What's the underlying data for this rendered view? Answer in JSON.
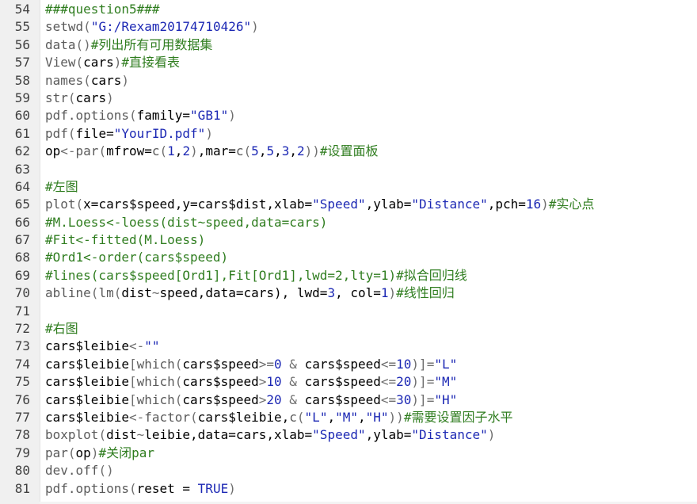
{
  "editor": {
    "lines": [
      {
        "n": "54",
        "segs": [
          {
            "t": "###question5###",
            "c": "cm"
          }
        ]
      },
      {
        "n": "55",
        "segs": [
          {
            "t": "setwd",
            "c": "fn"
          },
          {
            "t": "(",
            "c": "op"
          },
          {
            "t": "\"G:/Rexam20174710426\"",
            "c": "str"
          },
          {
            "t": ")",
            "c": "op"
          }
        ]
      },
      {
        "n": "56",
        "segs": [
          {
            "t": "data",
            "c": "fn"
          },
          {
            "t": "()",
            "c": "op"
          },
          {
            "t": "#列出所有可用数据集",
            "c": "cm"
          }
        ]
      },
      {
        "n": "57",
        "segs": [
          {
            "t": "View",
            "c": "fn"
          },
          {
            "t": "(",
            "c": "op"
          },
          {
            "t": "cars",
            "c": ""
          },
          {
            "t": ")",
            "c": "op"
          },
          {
            "t": "#直接看表",
            "c": "cm"
          }
        ]
      },
      {
        "n": "58",
        "segs": [
          {
            "t": "names",
            "c": "fn"
          },
          {
            "t": "(",
            "c": "op"
          },
          {
            "t": "cars",
            "c": ""
          },
          {
            "t": ")",
            "c": "op"
          }
        ]
      },
      {
        "n": "59",
        "segs": [
          {
            "t": "str",
            "c": "fn"
          },
          {
            "t": "(",
            "c": "op"
          },
          {
            "t": "cars",
            "c": ""
          },
          {
            "t": ")",
            "c": "op"
          }
        ]
      },
      {
        "n": "60",
        "segs": [
          {
            "t": "pdf.options",
            "c": "fn"
          },
          {
            "t": "(",
            "c": "op"
          },
          {
            "t": "family=",
            "c": ""
          },
          {
            "t": "\"GB1\"",
            "c": "str"
          },
          {
            "t": ")",
            "c": "op"
          }
        ]
      },
      {
        "n": "61",
        "segs": [
          {
            "t": "pdf",
            "c": "fn"
          },
          {
            "t": "(",
            "c": "op"
          },
          {
            "t": "file=",
            "c": ""
          },
          {
            "t": "\"YourID.pdf\"",
            "c": "str"
          },
          {
            "t": ")",
            "c": "op"
          }
        ]
      },
      {
        "n": "62",
        "segs": [
          {
            "t": "op",
            "c": ""
          },
          {
            "t": "<-",
            "c": "op"
          },
          {
            "t": "par",
            "c": "fn"
          },
          {
            "t": "(",
            "c": "op"
          },
          {
            "t": "mfrow=",
            "c": ""
          },
          {
            "t": "c",
            "c": "fn"
          },
          {
            "t": "(",
            "c": "op"
          },
          {
            "t": "1",
            "c": "num"
          },
          {
            "t": ",",
            "c": ""
          },
          {
            "t": "2",
            "c": "num"
          },
          {
            "t": ")",
            "c": "op"
          },
          {
            "t": ",mar=",
            "c": ""
          },
          {
            "t": "c",
            "c": "fn"
          },
          {
            "t": "(",
            "c": "op"
          },
          {
            "t": "5",
            "c": "num"
          },
          {
            "t": ",",
            "c": ""
          },
          {
            "t": "5",
            "c": "num"
          },
          {
            "t": ",",
            "c": ""
          },
          {
            "t": "3",
            "c": "num"
          },
          {
            "t": ",",
            "c": ""
          },
          {
            "t": "2",
            "c": "num"
          },
          {
            "t": "))",
            "c": "op"
          },
          {
            "t": "#设置面板",
            "c": "cm"
          }
        ]
      },
      {
        "n": "63",
        "segs": []
      },
      {
        "n": "64",
        "segs": [
          {
            "t": "#左图",
            "c": "cm"
          }
        ]
      },
      {
        "n": "65",
        "segs": [
          {
            "t": "plot",
            "c": "fn"
          },
          {
            "t": "(",
            "c": "op"
          },
          {
            "t": "x=cars$speed,y=cars$dist,xlab=",
            "c": ""
          },
          {
            "t": "\"Speed\"",
            "c": "str"
          },
          {
            "t": ",ylab=",
            "c": ""
          },
          {
            "t": "\"Distance\"",
            "c": "str"
          },
          {
            "t": ",pch=",
            "c": ""
          },
          {
            "t": "16",
            "c": "num"
          },
          {
            "t": ")",
            "c": "op"
          },
          {
            "t": "#实心点",
            "c": "cm"
          }
        ]
      },
      {
        "n": "66",
        "segs": [
          {
            "t": "#M.Loess<-loess(dist~speed,data=cars)",
            "c": "cm"
          }
        ]
      },
      {
        "n": "67",
        "segs": [
          {
            "t": "#Fit<-fitted(M.Loess)",
            "c": "cm"
          }
        ]
      },
      {
        "n": "68",
        "segs": [
          {
            "t": "#Ord1<-order(cars$speed)",
            "c": "cm"
          }
        ]
      },
      {
        "n": "69",
        "segs": [
          {
            "t": "#lines(cars$speed[Ord1],Fit[Ord1],lwd=2,lty=1)#拟合回归线",
            "c": "cm"
          }
        ]
      },
      {
        "n": "70",
        "segs": [
          {
            "t": "abline",
            "c": "fn"
          },
          {
            "t": "(",
            "c": "op"
          },
          {
            "t": "lm",
            "c": "fn"
          },
          {
            "t": "(",
            "c": "op"
          },
          {
            "t": "dist",
            "c": ""
          },
          {
            "t": "~",
            "c": "op"
          },
          {
            "t": "speed,data=cars), lwd=",
            "c": ""
          },
          {
            "t": "3",
            "c": "num"
          },
          {
            "t": ", col=",
            "c": ""
          },
          {
            "t": "1",
            "c": "num"
          },
          {
            "t": ")",
            "c": "op"
          },
          {
            "t": "#线性回归",
            "c": "cm"
          }
        ]
      },
      {
        "n": "71",
        "segs": []
      },
      {
        "n": "72",
        "segs": [
          {
            "t": "#右图",
            "c": "cm"
          }
        ]
      },
      {
        "n": "73",
        "segs": [
          {
            "t": "cars$leibie",
            "c": ""
          },
          {
            "t": "<-",
            "c": "op"
          },
          {
            "t": "\"\"",
            "c": "str"
          }
        ]
      },
      {
        "n": "74",
        "segs": [
          {
            "t": "cars$leibie",
            "c": ""
          },
          {
            "t": "[",
            "c": "op"
          },
          {
            "t": "which",
            "c": "fn"
          },
          {
            "t": "(",
            "c": "op"
          },
          {
            "t": "cars$speed",
            "c": ""
          },
          {
            "t": ">=",
            "c": "op"
          },
          {
            "t": "0",
            "c": "num"
          },
          {
            "t": " & ",
            "c": "op"
          },
          {
            "t": "cars$speed",
            "c": ""
          },
          {
            "t": "<=",
            "c": "op"
          },
          {
            "t": "10",
            "c": "num"
          },
          {
            "t": ")]=",
            "c": "op"
          },
          {
            "t": "\"L\"",
            "c": "str"
          }
        ]
      },
      {
        "n": "75",
        "segs": [
          {
            "t": "cars$leibie",
            "c": ""
          },
          {
            "t": "[",
            "c": "op"
          },
          {
            "t": "which",
            "c": "fn"
          },
          {
            "t": "(",
            "c": "op"
          },
          {
            "t": "cars$speed",
            "c": ""
          },
          {
            "t": ">",
            "c": "op"
          },
          {
            "t": "10",
            "c": "num"
          },
          {
            "t": " & ",
            "c": "op"
          },
          {
            "t": "cars$speed",
            "c": ""
          },
          {
            "t": "<=",
            "c": "op"
          },
          {
            "t": "20",
            "c": "num"
          },
          {
            "t": ")]=",
            "c": "op"
          },
          {
            "t": "\"M\"",
            "c": "str"
          }
        ]
      },
      {
        "n": "76",
        "segs": [
          {
            "t": "cars$leibie",
            "c": ""
          },
          {
            "t": "[",
            "c": "op"
          },
          {
            "t": "which",
            "c": "fn"
          },
          {
            "t": "(",
            "c": "op"
          },
          {
            "t": "cars$speed",
            "c": ""
          },
          {
            "t": ">",
            "c": "op"
          },
          {
            "t": "20",
            "c": "num"
          },
          {
            "t": " & ",
            "c": "op"
          },
          {
            "t": "cars$speed",
            "c": ""
          },
          {
            "t": "<=",
            "c": "op"
          },
          {
            "t": "30",
            "c": "num"
          },
          {
            "t": ")]=",
            "c": "op"
          },
          {
            "t": "\"H\"",
            "c": "str"
          }
        ]
      },
      {
        "n": "77",
        "segs": [
          {
            "t": "cars$leibie",
            "c": ""
          },
          {
            "t": "<-",
            "c": "op"
          },
          {
            "t": "factor",
            "c": "fn"
          },
          {
            "t": "(",
            "c": "op"
          },
          {
            "t": "cars$leibie,",
            "c": ""
          },
          {
            "t": "c",
            "c": "fn"
          },
          {
            "t": "(",
            "c": "op"
          },
          {
            "t": "\"L\"",
            "c": "str"
          },
          {
            "t": ",",
            "c": ""
          },
          {
            "t": "\"M\"",
            "c": "str"
          },
          {
            "t": ",",
            "c": ""
          },
          {
            "t": "\"H\"",
            "c": "str"
          },
          {
            "t": "))",
            "c": "op"
          },
          {
            "t": "#需要设置因子水平",
            "c": "cm"
          }
        ]
      },
      {
        "n": "78",
        "segs": [
          {
            "t": "boxplot",
            "c": "fn"
          },
          {
            "t": "(",
            "c": "op"
          },
          {
            "t": "dist",
            "c": ""
          },
          {
            "t": "~",
            "c": "op"
          },
          {
            "t": "leibie,data=cars,xlab=",
            "c": ""
          },
          {
            "t": "\"Speed\"",
            "c": "str"
          },
          {
            "t": ",ylab=",
            "c": ""
          },
          {
            "t": "\"Distance\"",
            "c": "str"
          },
          {
            "t": ")",
            "c": "op"
          }
        ]
      },
      {
        "n": "79",
        "segs": [
          {
            "t": "par",
            "c": "fn"
          },
          {
            "t": "(",
            "c": "op"
          },
          {
            "t": "op",
            "c": ""
          },
          {
            "t": ")",
            "c": "op"
          },
          {
            "t": "#关闭par",
            "c": "cm"
          }
        ]
      },
      {
        "n": "80",
        "segs": [
          {
            "t": "dev.off",
            "c": "fn"
          },
          {
            "t": "()",
            "c": "op"
          }
        ]
      },
      {
        "n": "81",
        "segs": [
          {
            "t": "pdf.options",
            "c": "fn"
          },
          {
            "t": "(",
            "c": "op"
          },
          {
            "t": "reset = ",
            "c": ""
          },
          {
            "t": "TRUE",
            "c": "num"
          },
          {
            "t": ")",
            "c": "op"
          }
        ]
      }
    ]
  }
}
